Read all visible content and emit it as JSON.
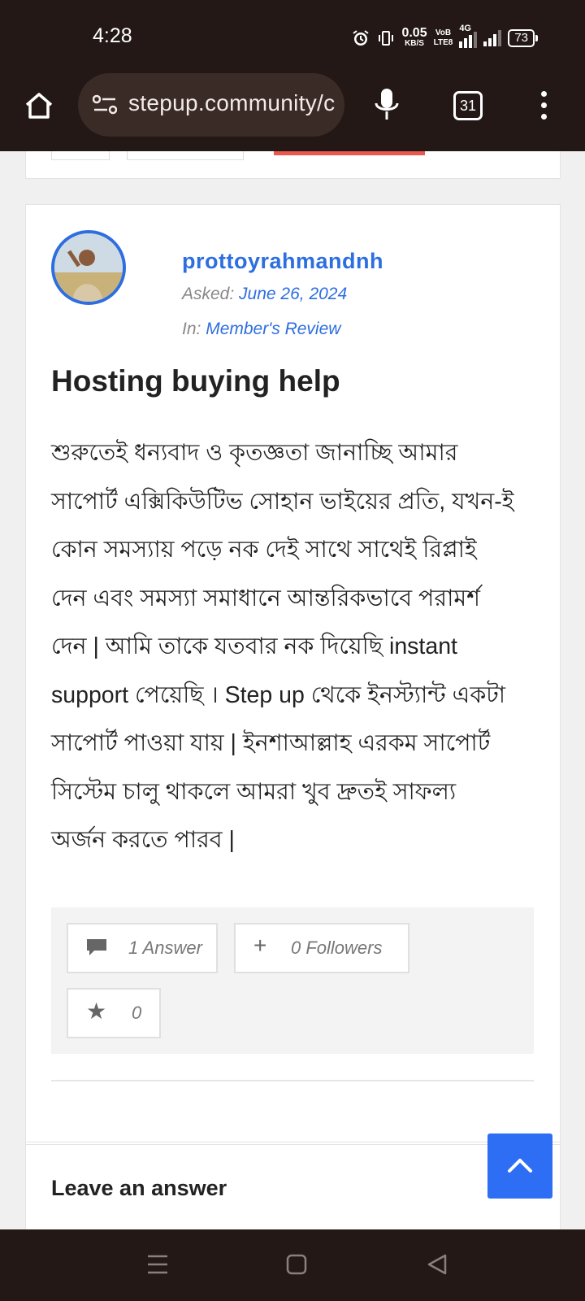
{
  "status_bar": {
    "time": "4:28",
    "net_speed_value": "0.05",
    "net_speed_unit": "KB/S",
    "volte_top": "VoB",
    "volte_bottom": "LTE8",
    "network": "4G",
    "battery": "73"
  },
  "browser": {
    "url": "stepup.community/c",
    "tab_count": "31"
  },
  "question": {
    "author": "prottoyrahmandnh",
    "asked_label": "Asked:",
    "asked_date": "June 26, 2024",
    "in_label": "In:",
    "category": "Member's Review",
    "title": "Hosting buying help",
    "body_lines": [
      "শুরুতেই ধন্যবাদ ও কৃতজ্ঞতা জানাচ্ছি আমার",
      "সাপোর্ট এক্সিকিউটিভ সোহান ভাইয়ের প্রতি, যখন-ই",
      "কোন সমস্যায় পড়ে নক দেই সাথে সাথেই রিপ্লাই",
      "দেন এবং সমস্যা সমাধানে আন্তরিকভাবে পরামর্শ",
      "দেন | আমি তাকে যতবার নক দিয়েছি instant",
      "support পেয়েছি । Step up থেকে ইনস্ট্যান্ট একটা",
      "সাপোর্ট পাওয়া যায় | ইনশাআল্লাহ এরকম সাপোর্ট",
      "সিস্টেম চালু থাকলে আমরা খুব দ্রুতই সাফল্য",
      "অর্জন করতে পারব |"
    ],
    "answers": "1 Answer",
    "followers": "0 Followers",
    "votes": "0"
  },
  "leave_answer": "Leave an answer",
  "colors": {
    "accent": "#2d6ee0",
    "system_bar": "#231815",
    "scroll_top_button": "#2d6ef5"
  }
}
